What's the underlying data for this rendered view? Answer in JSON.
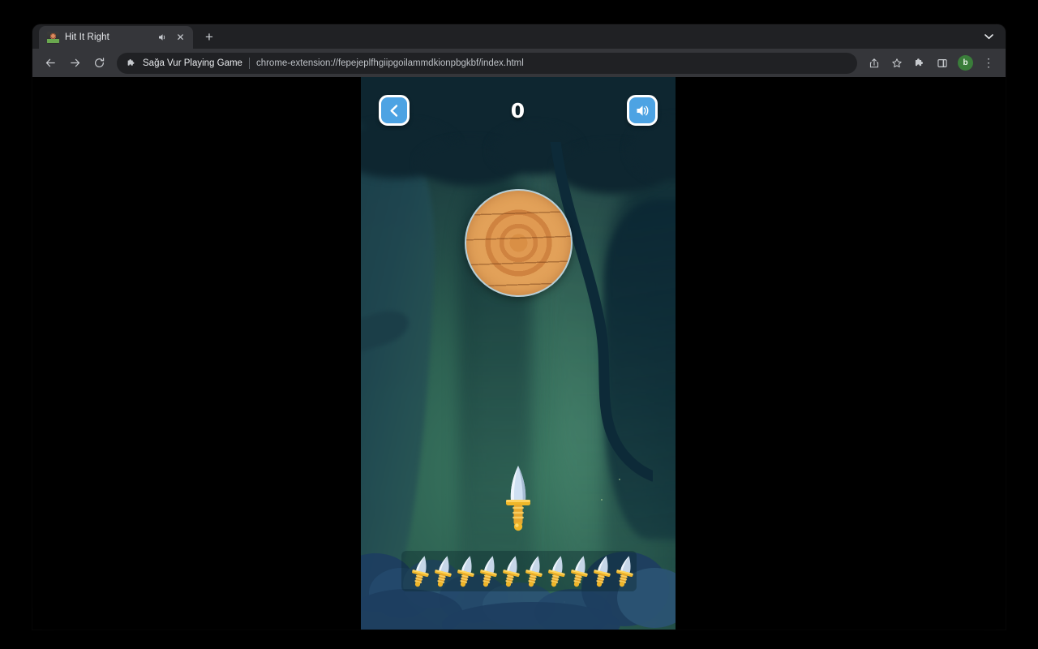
{
  "browser": {
    "tab": {
      "title": "Hit It Right",
      "favicon_name": "game-favicon",
      "audio_icon": "speaker-icon",
      "close_icon": "✕"
    },
    "new_tab_label": "+",
    "tabstrip_chevron": "⌄",
    "nav": {
      "back_label": "←",
      "forward_label": "→",
      "reload_label": "⟳"
    },
    "omnibox": {
      "site_name": "Sağa Vur Playing Game",
      "url": "chrome-extension://fepejeplfhgiipgoilammdkionpbgkbf/index.html",
      "divider": "|"
    },
    "toolbar_icons": [
      "share-icon",
      "bookmark-star-icon",
      "extensions-puzzle-icon",
      "side-panel-icon"
    ],
    "profile_initial": "b",
    "menu_label": "⋮",
    "colors": {
      "tabstrip_bg": "#202124",
      "toolbar_bg": "#35363a",
      "omnibox_bg": "#202124",
      "text": "#e8eaed",
      "profile_bg": "#3a7d3a"
    }
  },
  "game": {
    "title": "Hit It Right",
    "score": "0",
    "back_button_label": "back-button",
    "sound_button_label": "sound-on-button",
    "knives_remaining": 10,
    "knife_rack_count": 10,
    "target_name": "wooden-target",
    "colors": {
      "hud_button": "#4da3e3",
      "hud_button_border": "#ffffff",
      "background_green": "#2d6152",
      "canopy_dark": "#0e2630",
      "target_wood": "#e2a159",
      "target_ring": "#cf8340",
      "knife_blade": "#c9d8ea",
      "knife_handle": "#e8a82e",
      "bush_blue": "#24496b",
      "score_text": "#ffffff"
    }
  }
}
